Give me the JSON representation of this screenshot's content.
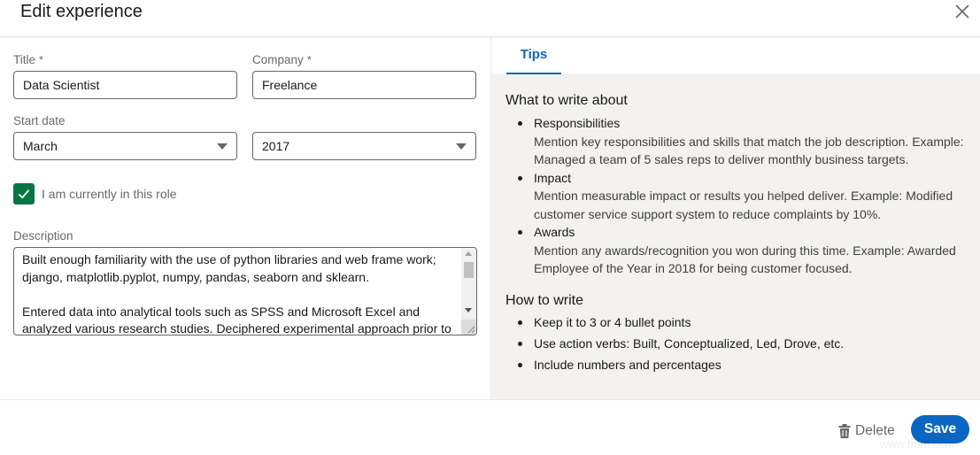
{
  "header": {
    "title": "Edit experience",
    "close_icon": "close-icon"
  },
  "form": {
    "title_label": "Title",
    "title_value": "Data Scientist",
    "company_label": "Company",
    "company_value": "Freelance",
    "required_marker": "*",
    "start_date_label": "Start date",
    "start_month": "March",
    "start_year": "2017",
    "current_role_label": "I am currently in this role",
    "current_role_checked": true,
    "description_label": "Description",
    "description_value": "Built enough familiarity with the use of python libraries and web frame work; django, matplotlib.pyplot, numpy, pandas, seaborn and sklearn.\n\nEntered data into analytical tools such as SPSS and Microsoft Excel and analyzed various research studies. Deciphered experimental approach prior to"
  },
  "tips": {
    "tab_label": "Tips",
    "section1_heading": "What to write about",
    "section1_items": [
      {
        "title": "Responsibilities",
        "body": "Mention key responsibilities and skills that match the job description. Example: Managed a team of 5 sales reps to deliver monthly business targets."
      },
      {
        "title": "Impact",
        "body": "Mention measurable impact or results you helped deliver. Example: Modified customer service support system to reduce complaints by 10%."
      },
      {
        "title": "Awards",
        "body": "Mention any awards/recognition you won during this time. Example: Awarded Employee of the Year in 2018 for being customer focused."
      }
    ],
    "section2_heading": "How to write",
    "section2_items": [
      "Keep it to 3 or 4 bullet points",
      "Use action verbs: Built, Conceptualized, Led, Drove, etc.",
      "Include numbers and percentages"
    ]
  },
  "footer": {
    "delete_label": "Delete",
    "save_label": "Save",
    "watermark": "www.fmm.com"
  },
  "colors": {
    "accent": "#0a66c2",
    "checkbox": "#057642",
    "tips_background": "#f3f2ef"
  }
}
